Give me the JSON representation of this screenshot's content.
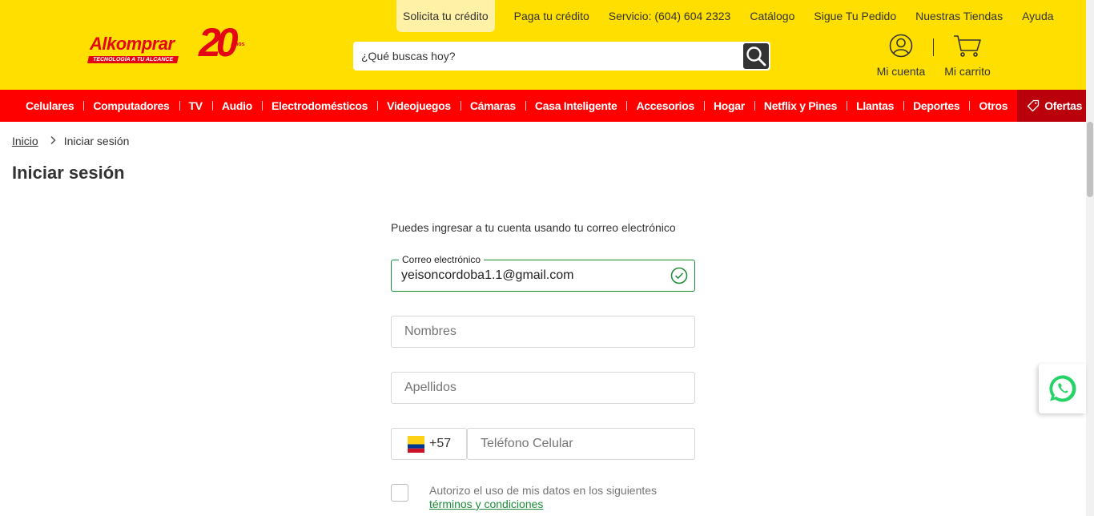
{
  "header": {
    "logo_text": "Alkomprar",
    "logo_tagline": "TECNOLOGÍA A TU ALCANCE",
    "logo_anniversary": "20",
    "logo_anniversary_suffix": "Años",
    "top_links": [
      "Solicita tu crédito",
      "Paga tu crédito",
      "Servicio: (604) 604 2323",
      "Catálogo",
      "Sigue Tu Pedido",
      "Nuestras Tiendas",
      "Ayuda"
    ],
    "search_placeholder": "¿Qué buscas hoy?",
    "account_label": "Mi cuenta",
    "cart_label": "Mi carrito"
  },
  "nav": {
    "items": [
      "Celulares",
      "Computadores",
      "TV",
      "Audio",
      "Electrodomésticos",
      "Videojuegos",
      "Cámaras",
      "Casa Inteligente",
      "Accesorios",
      "Hogar",
      "Netflix y Pines",
      "Llantas",
      "Deportes",
      "Otros"
    ],
    "offers_label": "Ofertas"
  },
  "breadcrumb": {
    "home": "Inicio",
    "current": "Iniciar sesión"
  },
  "page_title": "Iniciar sesión",
  "form": {
    "intro": "Puedes ingresar a tu cuenta usando tu correo electrónico",
    "email_label": "Correo electrónico",
    "email_value": "yeisoncordoba1.1@gmail.com",
    "first_name_placeholder": "Nombres",
    "last_name_placeholder": "Apellidos",
    "phone_code": "+57",
    "phone_placeholder": "Teléfono Celular",
    "consent_text": "Autorizo el uso de mis datos en los siguientes",
    "consent_link": "términos y condiciones"
  },
  "colors": {
    "header_yellow": "#ffdf00",
    "nav_red": "#fe0000",
    "offers_bg": "#b9000b",
    "valid_green": "#1e8a3a"
  }
}
